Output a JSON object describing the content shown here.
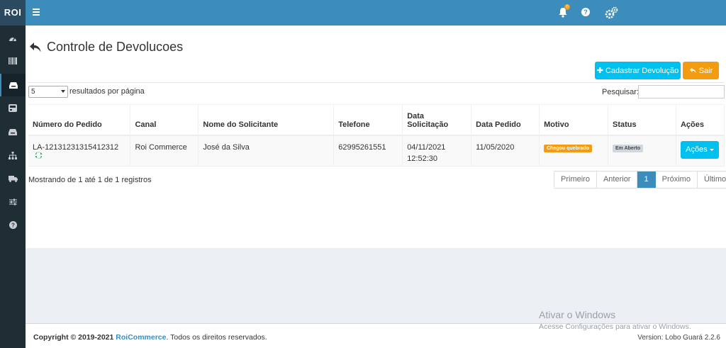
{
  "app": {
    "brand": "ROI"
  },
  "topbar": {
    "notification_count": "0",
    "help_glyph": "?"
  },
  "sidebar": {
    "items": [
      {
        "icon": "dashboard-icon"
      },
      {
        "icon": "barcode-icon"
      },
      {
        "icon": "inbox-icon",
        "active": true
      },
      {
        "icon": "credit-card-icon"
      },
      {
        "icon": "inbox-icon"
      },
      {
        "icon": "sitemap-icon"
      },
      {
        "icon": "truck-icon"
      },
      {
        "icon": "sliders-icon"
      },
      {
        "icon": "question-circle-icon"
      }
    ]
  },
  "page": {
    "title": "Controle de Devolucoes"
  },
  "actions": {
    "cadastrar": "Cadastrar Devolução",
    "sair": "Sair"
  },
  "table_controls": {
    "page_length": "5",
    "length_label": "resultados por página",
    "search_label": "Pesquisar:",
    "search_value": ""
  },
  "table": {
    "headers": [
      "Número do Pedido",
      "Canal",
      "Nome do Solicitante",
      "Telefone",
      "Data Solicitação",
      "Data Pedido",
      "Motivo",
      "Status",
      "Ações"
    ],
    "rows": [
      {
        "pedido": "LA-12131231315412312",
        "canal": "Roi Commerce",
        "solicitante": "José da Silva",
        "telefone": "62995261551",
        "data_solicitacao": "04/11/2021 12:52:30",
        "data_pedido": "11/05/2020",
        "motivo": "Chegou quebrado",
        "status": "Em Aberto",
        "acoes": "Ações"
      }
    ]
  },
  "info": "Mostrando de 1 até 1 de 1 registros",
  "pagination": {
    "first": "Primeiro",
    "prev": "Anterior",
    "current": "1",
    "next": "Próximo",
    "last": "Último"
  },
  "footer": {
    "copy_prefix": "Copyright © 2019-2021",
    "brand": "RoiCommerce",
    "copy_suffix": ". Todos os direitos reservados.",
    "version": "Version: Lobo Guará 2.2.6"
  },
  "watermark": {
    "line1": "Ativar o Windows",
    "line2": "Acesse Configurações para ativar o Windows."
  },
  "colors": {
    "primary": "#3c8dbc",
    "info": "#00c0ef",
    "warning": "#f39c12",
    "sidebar": "#1f2d35"
  }
}
